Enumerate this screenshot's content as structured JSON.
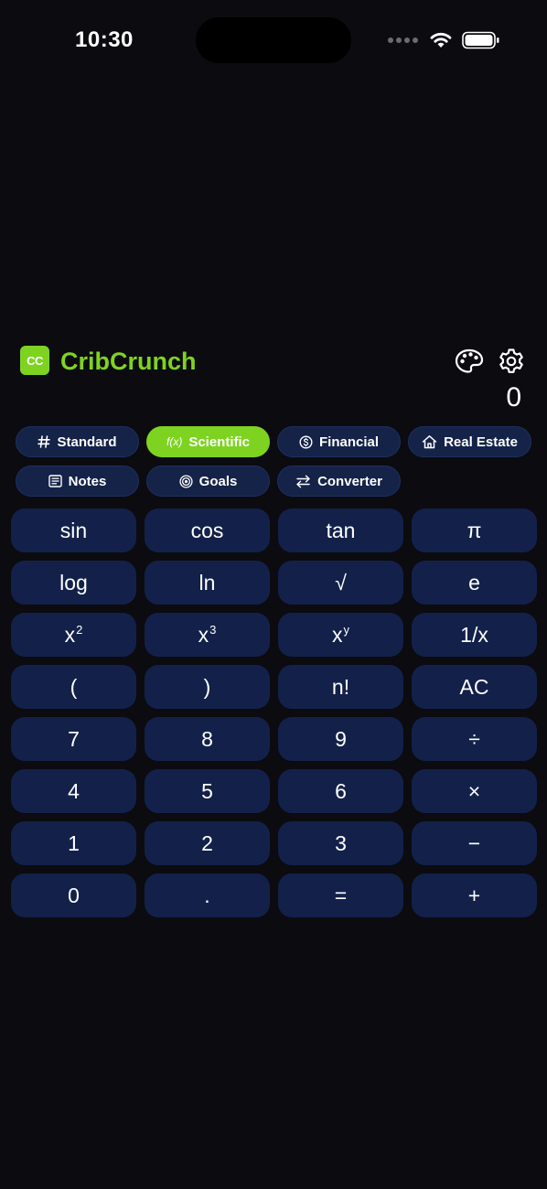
{
  "status_bar": {
    "time": "10:30"
  },
  "app": {
    "logo_text": "CC",
    "title": "CribCrunch"
  },
  "display": {
    "value": "0"
  },
  "tabs": [
    {
      "label": "Standard",
      "icon": "hash-icon"
    },
    {
      "label": "Scientific",
      "icon": "function-icon",
      "icon_text": "f(x)",
      "active": true
    },
    {
      "label": "Financial",
      "icon": "dollar-circle-icon"
    },
    {
      "label": "Real Estate",
      "icon": "house-icon"
    },
    {
      "label": "Notes",
      "icon": "notes-icon"
    },
    {
      "label": "Goals",
      "icon": "target-icon"
    },
    {
      "label": "Converter",
      "icon": "swap-arrows-icon"
    }
  ],
  "keys": [
    [
      "sin",
      "cos",
      "tan",
      "π"
    ],
    [
      "log",
      "ln",
      "√",
      "e"
    ],
    [
      "x",
      "x",
      "x",
      "1/x"
    ],
    [
      "(",
      ")",
      "n!",
      "AC"
    ],
    [
      "7",
      "8",
      "9",
      "÷"
    ],
    [
      "4",
      "5",
      "6",
      "×"
    ],
    [
      "1",
      "2",
      "3",
      "−"
    ],
    [
      "0",
      ".",
      "=",
      "+"
    ]
  ],
  "key_superscripts": {
    "square": "2",
    "cube": "3",
    "power": "y"
  },
  "colors": {
    "accent": "#7ed321",
    "key_bg": "#13214a",
    "background": "#0b0b10"
  }
}
